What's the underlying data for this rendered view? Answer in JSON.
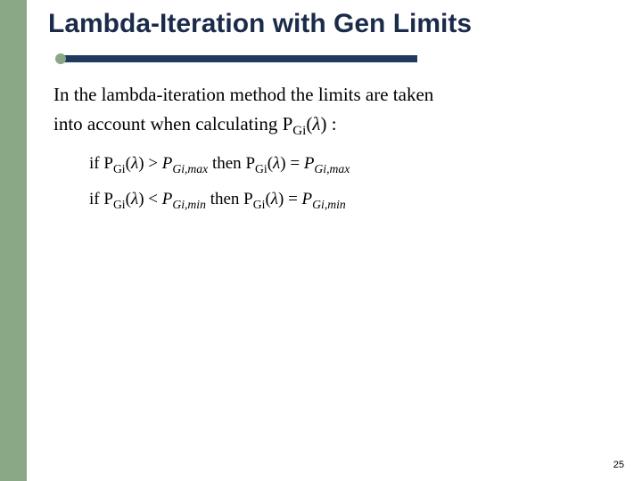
{
  "title": "Lambda-Iteration with Gen Limits",
  "intro_line1": "In the lambda-iteration method the limits are taken",
  "intro_line2_prefix": "into account when calculating ",
  "intro_line2_suffix": " :",
  "pgi_lambda": {
    "P": "P",
    "sub": "Gi",
    "lparen": "(",
    "lambda": "λ",
    "rparen": ")"
  },
  "eq1": {
    "if": "if ",
    "gt": " > ",
    "then": " then ",
    "eq": " = ",
    "limit_sub": "Gi,max"
  },
  "eq2": {
    "if": "if ",
    "lt": " < ",
    "then": " then ",
    "eq": " = ",
    "limit_sub": "Gi,min"
  },
  "page_number": "25"
}
